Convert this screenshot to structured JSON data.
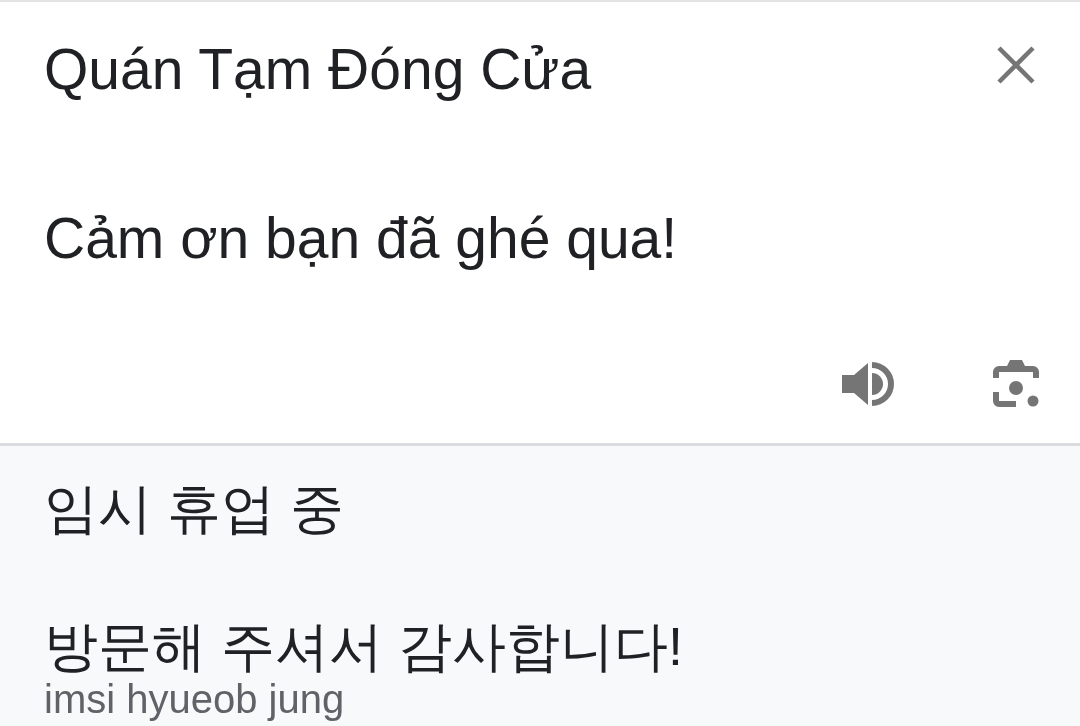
{
  "source": {
    "title": "Quán Tạm Đóng Cửa",
    "text": "Cảm ơn bạn đã ghé qua!"
  },
  "translation": {
    "title": "임시 휴업 중",
    "text": "방문해 주셔서 감사합니다!",
    "romanization": "imsi hyueob jung"
  }
}
